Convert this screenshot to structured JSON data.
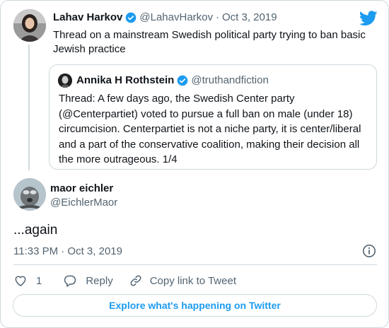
{
  "colors": {
    "accent": "#1d9bf0",
    "text": "#0f1419",
    "muted": "#536471",
    "border": "#cfd9de",
    "like": "#536471"
  },
  "icons": {
    "logo": "twitter-bird-icon",
    "verified": "verified-badge-icon",
    "info": "info-icon",
    "like": "heart-icon",
    "reply": "reply-icon",
    "copy": "link-icon"
  },
  "parent_tweet": {
    "name": "Lahav Harkov",
    "handle": "@LahavHarkov",
    "separator": "·",
    "date": "Oct 3, 2019",
    "text": "Thread on a mainstream Swedish political party trying to ban basic Jewish practice"
  },
  "quoted_tweet": {
    "name": "Annika H Rothstein",
    "handle": "@truthandfiction",
    "text": "Thread: A few days ago, the Swedish Center party (@Centerpartiet) voted to pursue a full ban on male (under 18) circumcision. Centerpartiet is not a niche party, it is center/liberal and a part of the conservative coalition, making their decision all the more outrageous. 1/4"
  },
  "main_tweet": {
    "name": "maor eichler",
    "handle": "@EichlerMaor",
    "text": "...again",
    "timestamp": "11:33 PM · Oct 3, 2019"
  },
  "actions": {
    "like_count": "1",
    "reply_label": "Reply",
    "copy_label": "Copy link to Tweet"
  },
  "explore_label": "Explore what's happening on Twitter"
}
